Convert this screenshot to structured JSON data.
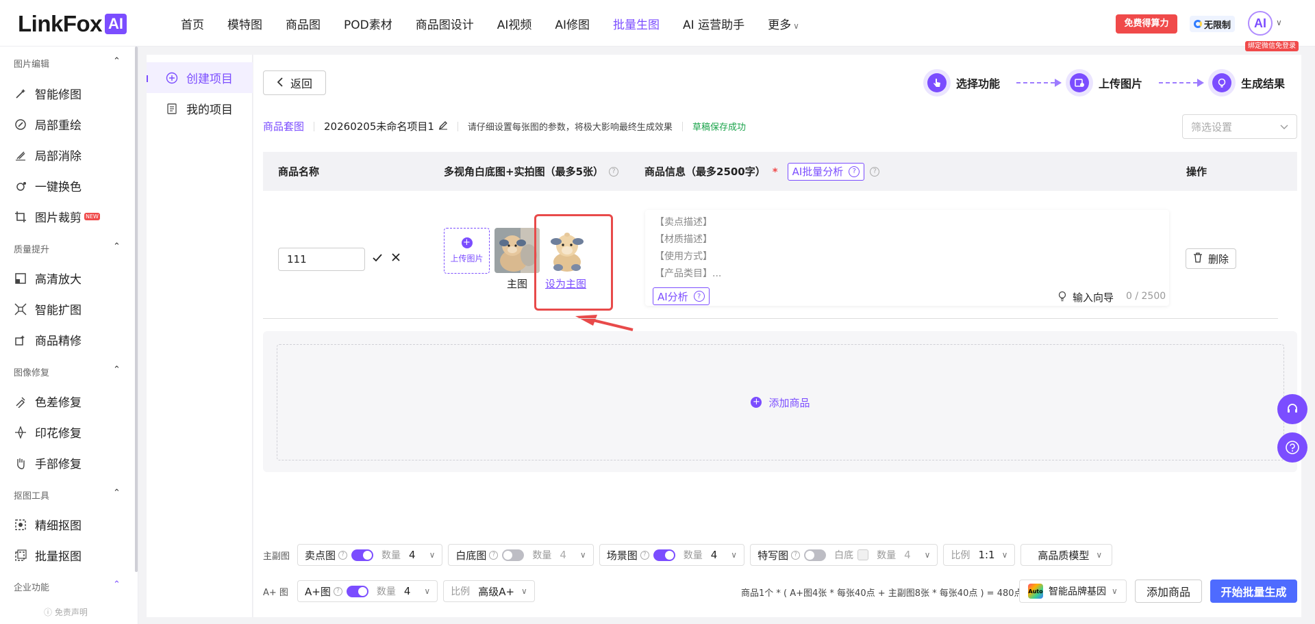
{
  "brand": {
    "name": "LinkFox",
    "badge": "AI"
  },
  "nav": {
    "items": [
      "首页",
      "模特图",
      "商品图",
      "POD素材",
      "商品图设计",
      "AI视频",
      "AI修图",
      "批量生图",
      "AI 运营助手"
    ],
    "more": "更多",
    "active": "批量生图"
  },
  "header": {
    "free_power": "免费得算力",
    "unlimited": "无限制",
    "avatar_text": "AI",
    "binding_tip": "绑定微信免登录"
  },
  "sidebar": {
    "sections": [
      {
        "title": "图片编辑",
        "items": [
          {
            "label": "智能修图",
            "icon": "magic-wand-icon"
          },
          {
            "label": "局部重绘",
            "icon": "brush-edit-icon"
          },
          {
            "label": "局部消除",
            "icon": "eraser-icon"
          },
          {
            "label": "一键换色",
            "icon": "color-drop-icon"
          },
          {
            "label": "图片裁剪",
            "icon": "crop-icon",
            "tag": "NEW"
          }
        ]
      },
      {
        "title": "质量提升",
        "items": [
          {
            "label": "高清放大",
            "icon": "hd-upscale-icon"
          },
          {
            "label": "智能扩图",
            "icon": "expand-icon"
          },
          {
            "label": "商品精修",
            "icon": "retouch-icon"
          }
        ]
      },
      {
        "title": "图像修复",
        "items": [
          {
            "label": "色差修复",
            "icon": "color-fix-icon"
          },
          {
            "label": "印花修复",
            "icon": "pattern-fix-icon"
          },
          {
            "label": "手部修复",
            "icon": "hand-icon"
          }
        ]
      },
      {
        "title": "抠图工具",
        "items": [
          {
            "label": "精细抠图",
            "icon": "cutout-icon"
          },
          {
            "label": "批量抠图",
            "icon": "batch-cutout-icon"
          }
        ]
      },
      {
        "title": "企业功能",
        "items": []
      }
    ],
    "disclaimer": "免责声明"
  },
  "projects": {
    "create": "创建项目",
    "mine": "我的项目"
  },
  "toolbar": {
    "back": "返回"
  },
  "steps": [
    "选择功能",
    "上传图片",
    "生成结果"
  ],
  "crumbs": {
    "type": "商品套图",
    "project_name": "20260205未命名项目1",
    "hint": "请仔细设置每张图的参数，将极大影响最终生成效果",
    "saved": "草稿保存成功"
  },
  "filter": {
    "placeholder": "筛选设置"
  },
  "table": {
    "headers": {
      "name": "商品名称",
      "images": "多视角白底图+实拍图（最多5张）",
      "info": "商品信息（最多2500字）",
      "ai_batch": "AI批量分析",
      "action": "操作"
    },
    "row": {
      "name_value": "111",
      "upload": "上传图片",
      "main_caption": "主图",
      "set_main": "设为主图",
      "info_lines": [
        "【卖点描述】",
        "【材质描述】",
        "【使用方式】",
        "【产品类目】..."
      ],
      "ai_analysis": "AI分析",
      "guide": "输入向导",
      "counter": "0 / 2500",
      "delete": "删除"
    }
  },
  "add_product": "添加商品",
  "settings": {
    "row1_label": "主副图",
    "selling": {
      "label": "卖点图",
      "qty_label": "数量",
      "qty": "4",
      "on": true
    },
    "white": {
      "label": "白底图",
      "qty_label": "数量",
      "qty": "4",
      "on": false
    },
    "scene": {
      "label": "场景图",
      "qty_label": "数量",
      "qty": "4",
      "on": true
    },
    "closeup": {
      "label": "特写图",
      "bg_label": "白底",
      "qty_label": "数量",
      "qty": "4",
      "on": false
    },
    "ratio": {
      "label": "比例",
      "value": "1:1"
    },
    "model": "高品质模型",
    "row2_label": "A+ 图",
    "aplus": {
      "label": "A+图",
      "qty_label": "数量",
      "qty": "4",
      "on": true
    },
    "aplus_ratio": {
      "label": "比例",
      "value": "高级A+"
    }
  },
  "footer": {
    "formula": "商品1个 * ( A+图4张 * 每张40点 + 主副图8张 * 每张40点 ) = 480点",
    "brand_gene": "智能品牌基因",
    "brand_logo": "Auto",
    "add_product": "添加商品",
    "start": "开始批量生成"
  },
  "colors": {
    "accent": "#7b4dff",
    "danger": "#f04a4a",
    "primary_btn": "#4e6bff",
    "success": "#1aa34a"
  }
}
